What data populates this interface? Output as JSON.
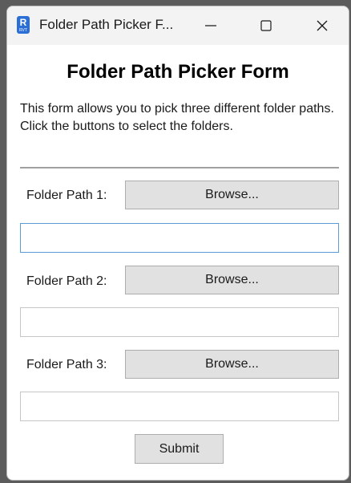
{
  "window": {
    "title": "Folder Path Picker F...",
    "app_icon_letter": "R",
    "app_icon_sub": "RVT"
  },
  "form": {
    "heading": "Folder Path Picker Form",
    "description_line1": "This form allows you to pick three different folder paths.",
    "description_line2": "Click the buttons to select the folders.",
    "fields": [
      {
        "label": "Folder Path 1:",
        "button": "Browse...",
        "value": ""
      },
      {
        "label": "Folder Path 2:",
        "button": "Browse...",
        "value": ""
      },
      {
        "label": "Folder Path 3:",
        "button": "Browse...",
        "value": ""
      }
    ],
    "submit_label": "Submit"
  },
  "colors": {
    "accent_focus": "#5a9bd8",
    "button_bg": "#e1e1e1",
    "icon_blue": "#2b6fd6"
  }
}
